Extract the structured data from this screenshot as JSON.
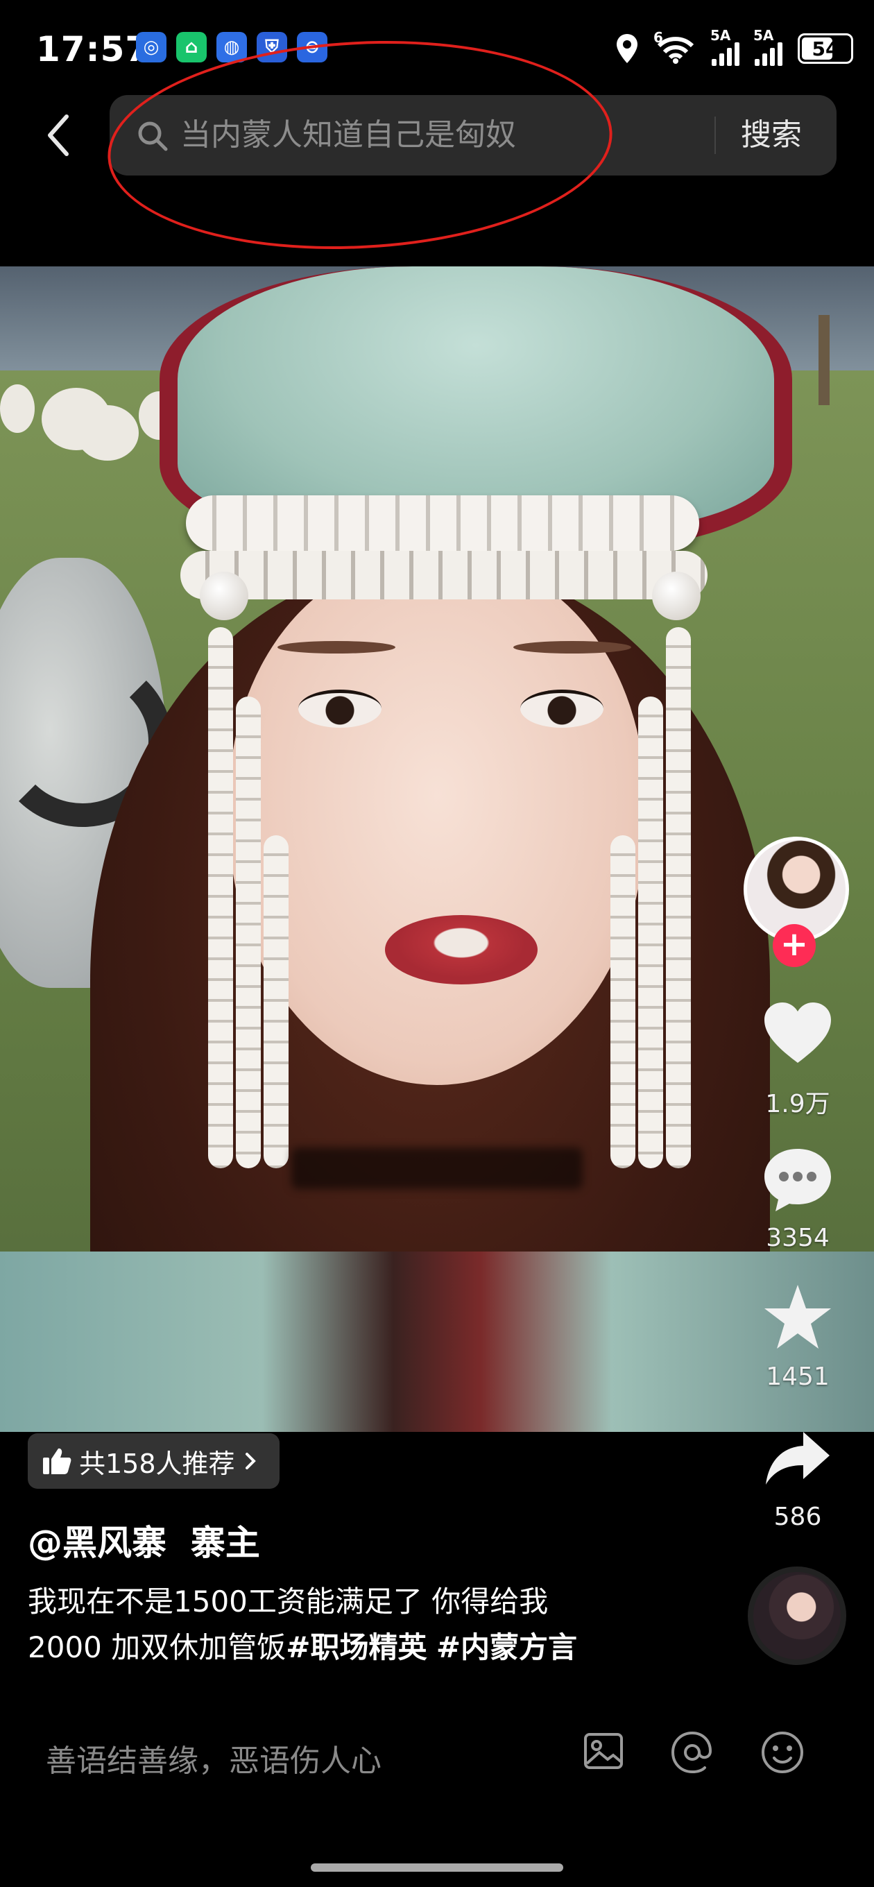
{
  "status_bar": {
    "time": "17:57",
    "network_label_1": "5A",
    "network_label_2": "5A",
    "wifi_label": "6",
    "battery": "54"
  },
  "search": {
    "query": "当内蒙人知道自己是匈奴",
    "button_label": "搜索"
  },
  "actions": {
    "likes": "1.9万",
    "comments": "3354",
    "favorites": "1451",
    "shares": "586"
  },
  "recommend": {
    "label": "共158人推荐"
  },
  "post": {
    "author": "@黑风寨  寨主",
    "description_line1": "我现在不是1500工资能满足了 你得给我",
    "description_line2_plain": "2000 加双休加管饭",
    "hashtag1": "#职场精英",
    "hashtag2": "#内蒙方言"
  },
  "comment_bar": {
    "placeholder": "善语结善缘，恶语伤人心"
  },
  "colors": {
    "accent_red": "#fe2c55",
    "annotation_red": "#e0201c",
    "background": "#000000"
  }
}
